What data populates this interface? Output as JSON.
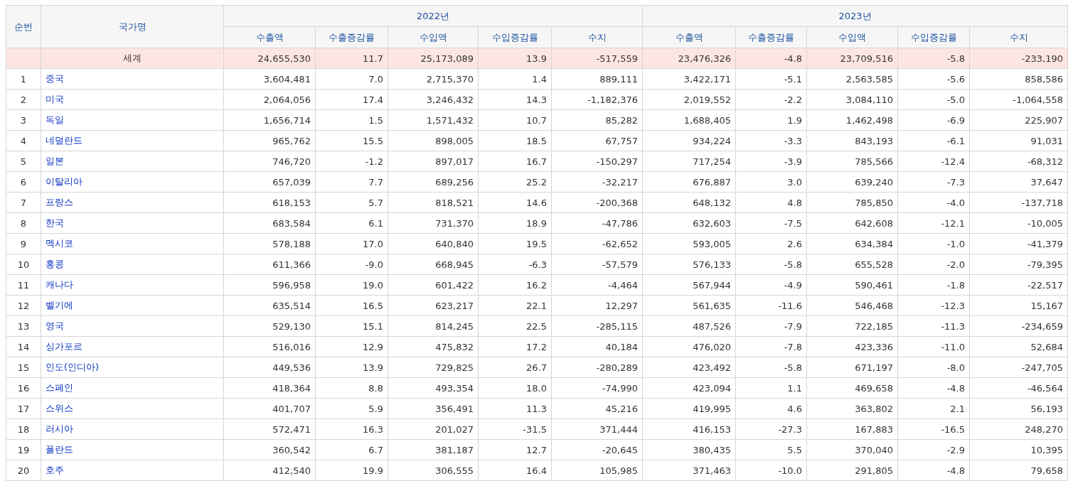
{
  "table": {
    "columns": {
      "rank": "순번",
      "country": "국가명",
      "years": [
        {
          "label": "2022년",
          "sub": [
            "수출액",
            "수출증감률",
            "수입액",
            "수입증감률",
            "수지"
          ]
        },
        {
          "label": "2023년",
          "sub": [
            "수출액",
            "수출증감률",
            "수입액",
            "수입증감률",
            "수지"
          ]
        }
      ]
    },
    "rows": [
      {
        "kind": "total",
        "rank": "",
        "country": "세계",
        "values": [
          "24,655,530",
          "11.7",
          "25,173,089",
          "13.9",
          "-517,559",
          "23,476,326",
          "-4.8",
          "23,709,516",
          "-5.8",
          "-233,190"
        ]
      },
      {
        "kind": "country",
        "rank": "1",
        "country": "중국",
        "values": [
          "3,604,481",
          "7.0",
          "2,715,370",
          "1.4",
          "889,111",
          "3,422,171",
          "-5.1",
          "2,563,585",
          "-5.6",
          "858,586"
        ]
      },
      {
        "kind": "country",
        "rank": "2",
        "country": "미국",
        "values": [
          "2,064,056",
          "17.4",
          "3,246,432",
          "14.3",
          "-1,182,376",
          "2,019,552",
          "-2.2",
          "3,084,110",
          "-5.0",
          "-1,064,558"
        ]
      },
      {
        "kind": "country",
        "rank": "3",
        "country": "독일",
        "values": [
          "1,656,714",
          "1.5",
          "1,571,432",
          "10.7",
          "85,282",
          "1,688,405",
          "1.9",
          "1,462,498",
          "-6.9",
          "225,907"
        ]
      },
      {
        "kind": "country",
        "rank": "4",
        "country": "네덜란드",
        "values": [
          "965,762",
          "15.5",
          "898,005",
          "18.5",
          "67,757",
          "934,224",
          "-3.3",
          "843,193",
          "-6.1",
          "91,031"
        ]
      },
      {
        "kind": "country",
        "rank": "5",
        "country": "일본",
        "values": [
          "746,720",
          "-1.2",
          "897,017",
          "16.7",
          "-150,297",
          "717,254",
          "-3.9",
          "785,566",
          "-12.4",
          "-68,312"
        ]
      },
      {
        "kind": "country",
        "rank": "6",
        "country": "이탈리아",
        "values": [
          "657,039",
          "7.7",
          "689,256",
          "25.2",
          "-32,217",
          "676,887",
          "3.0",
          "639,240",
          "-7.3",
          "37,647"
        ]
      },
      {
        "kind": "country",
        "rank": "7",
        "country": "프랑스",
        "values": [
          "618,153",
          "5.7",
          "818,521",
          "14.6",
          "-200,368",
          "648,132",
          "4.8",
          "785,850",
          "-4.0",
          "-137,718"
        ]
      },
      {
        "kind": "country",
        "rank": "8",
        "country": "한국",
        "values": [
          "683,584",
          "6.1",
          "731,370",
          "18.9",
          "-47,786",
          "632,603",
          "-7.5",
          "642,608",
          "-12.1",
          "-10,005"
        ]
      },
      {
        "kind": "country",
        "rank": "9",
        "country": "멕시코",
        "values": [
          "578,188",
          "17.0",
          "640,840",
          "19.5",
          "-62,652",
          "593,005",
          "2.6",
          "634,384",
          "-1.0",
          "-41,379"
        ]
      },
      {
        "kind": "country",
        "rank": "10",
        "country": "홍콩",
        "values": [
          "611,366",
          "-9.0",
          "668,945",
          "-6.3",
          "-57,579",
          "576,133",
          "-5.8",
          "655,528",
          "-2.0",
          "-79,395"
        ]
      },
      {
        "kind": "country",
        "rank": "11",
        "country": "캐나다",
        "values": [
          "596,958",
          "19.0",
          "601,422",
          "16.2",
          "-4,464",
          "567,944",
          "-4.9",
          "590,461",
          "-1.8",
          "-22,517"
        ]
      },
      {
        "kind": "country",
        "rank": "12",
        "country": "벨기에",
        "values": [
          "635,514",
          "16.5",
          "623,217",
          "22.1",
          "12,297",
          "561,635",
          "-11.6",
          "546,468",
          "-12.3",
          "15,167"
        ]
      },
      {
        "kind": "country",
        "rank": "13",
        "country": "영국",
        "values": [
          "529,130",
          "15.1",
          "814,245",
          "22.5",
          "-285,115",
          "487,526",
          "-7.9",
          "722,185",
          "-11.3",
          "-234,659"
        ]
      },
      {
        "kind": "country",
        "rank": "14",
        "country": "싱가포르",
        "values": [
          "516,016",
          "12.9",
          "475,832",
          "17.2",
          "40,184",
          "476,020",
          "-7.8",
          "423,336",
          "-11.0",
          "52,684"
        ]
      },
      {
        "kind": "country",
        "rank": "15",
        "country": "인도(인디아)",
        "values": [
          "449,536",
          "13.9",
          "729,825",
          "26.7",
          "-280,289",
          "423,492",
          "-5.8",
          "671,197",
          "-8.0",
          "-247,705"
        ]
      },
      {
        "kind": "country",
        "rank": "16",
        "country": "스페인",
        "values": [
          "418,364",
          "8.8",
          "493,354",
          "18.0",
          "-74,990",
          "423,094",
          "1.1",
          "469,658",
          "-4.8",
          "-46,564"
        ]
      },
      {
        "kind": "country",
        "rank": "17",
        "country": "스위스",
        "values": [
          "401,707",
          "5.9",
          "356,491",
          "11.3",
          "45,216",
          "419,995",
          "4.6",
          "363,802",
          "2.1",
          "56,193"
        ]
      },
      {
        "kind": "country",
        "rank": "18",
        "country": "러시아",
        "values": [
          "572,471",
          "16.3",
          "201,027",
          "-31.5",
          "371,444",
          "416,153",
          "-27.3",
          "167,883",
          "-16.5",
          "248,270"
        ]
      },
      {
        "kind": "country",
        "rank": "19",
        "country": "폴란드",
        "values": [
          "360,542",
          "6.7",
          "381,187",
          "12.7",
          "-20,645",
          "380,435",
          "5.5",
          "370,040",
          "-2.9",
          "10,395"
        ]
      },
      {
        "kind": "country",
        "rank": "20",
        "country": "호주",
        "values": [
          "412,540",
          "19.9",
          "306,555",
          "16.4",
          "105,985",
          "371,463",
          "-10.0",
          "291,805",
          "-4.8",
          "79,658"
        ]
      }
    ]
  }
}
